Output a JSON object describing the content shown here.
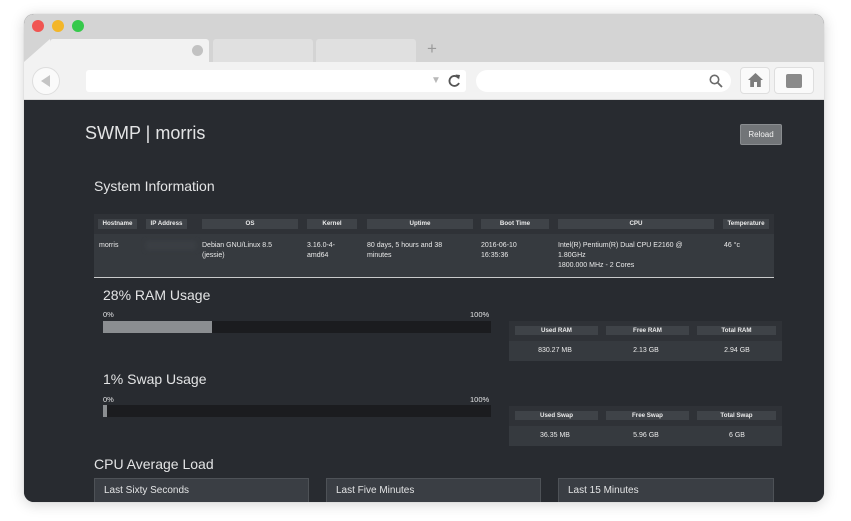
{
  "browser": {
    "tabs": [
      {
        "label": ""
      },
      {
        "label": ""
      },
      {
        "label": ""
      }
    ],
    "new_tab": "+",
    "url": "",
    "search": ""
  },
  "page": {
    "title": "SWMP | morris",
    "reload_label": "Reload"
  },
  "system_info": {
    "title": "System Information",
    "headers": [
      "Hostname",
      "IP Address",
      "OS",
      "Kernel",
      "Uptime",
      "Boot Time",
      "CPU",
      "Temperature"
    ],
    "hostname": "morris",
    "os_line1": "Debian GNU/Linux 8.5",
    "os_line2": "(jessie)",
    "kernel_line1": "3.16.0-4-",
    "kernel_line2": "amd64",
    "uptime_line1": "80 days, 5 hours and 38",
    "uptime_line2": "minutes",
    "boot_line1": "2016-06-10",
    "boot_line2": "16:35:36",
    "cpu_line1": "Intel(R) Pentium(R) Dual CPU E2160 @",
    "cpu_line2": "1.80GHz",
    "cpu_line3": "1800.000 MHz - 2 Cores",
    "temperature": "46 °c"
  },
  "ram": {
    "title": "28% RAM Usage",
    "percent": 28,
    "min_label": "0%",
    "max_label": "100%",
    "headers": [
      "Used RAM",
      "Free RAM",
      "Total RAM"
    ],
    "used": "830.27 MB",
    "free": "2.13 GB",
    "total": "2.94 GB"
  },
  "swap": {
    "title": "1% Swap Usage",
    "percent": 1,
    "min_label": "0%",
    "max_label": "100%",
    "headers": [
      "Used Swap",
      "Free Swap",
      "Total Swap"
    ],
    "used": "36.35 MB",
    "free": "5.96 GB",
    "total": "6 GB"
  },
  "cpu_load": {
    "title": "CPU Average Load",
    "cards": [
      "Last Sixty Seconds",
      "Last Five Minutes",
      "Last 15 Minutes"
    ]
  },
  "colors": {
    "page_bg": "#282b30",
    "bar_fill": "#8b8e91",
    "bar_track": "#1b1c1f",
    "reload_button": "#727578"
  },
  "icons": [
    "back-arrow-icon",
    "dropdown-caret-icon",
    "reload-icon",
    "search-icon",
    "home-icon",
    "extension-icon"
  ]
}
